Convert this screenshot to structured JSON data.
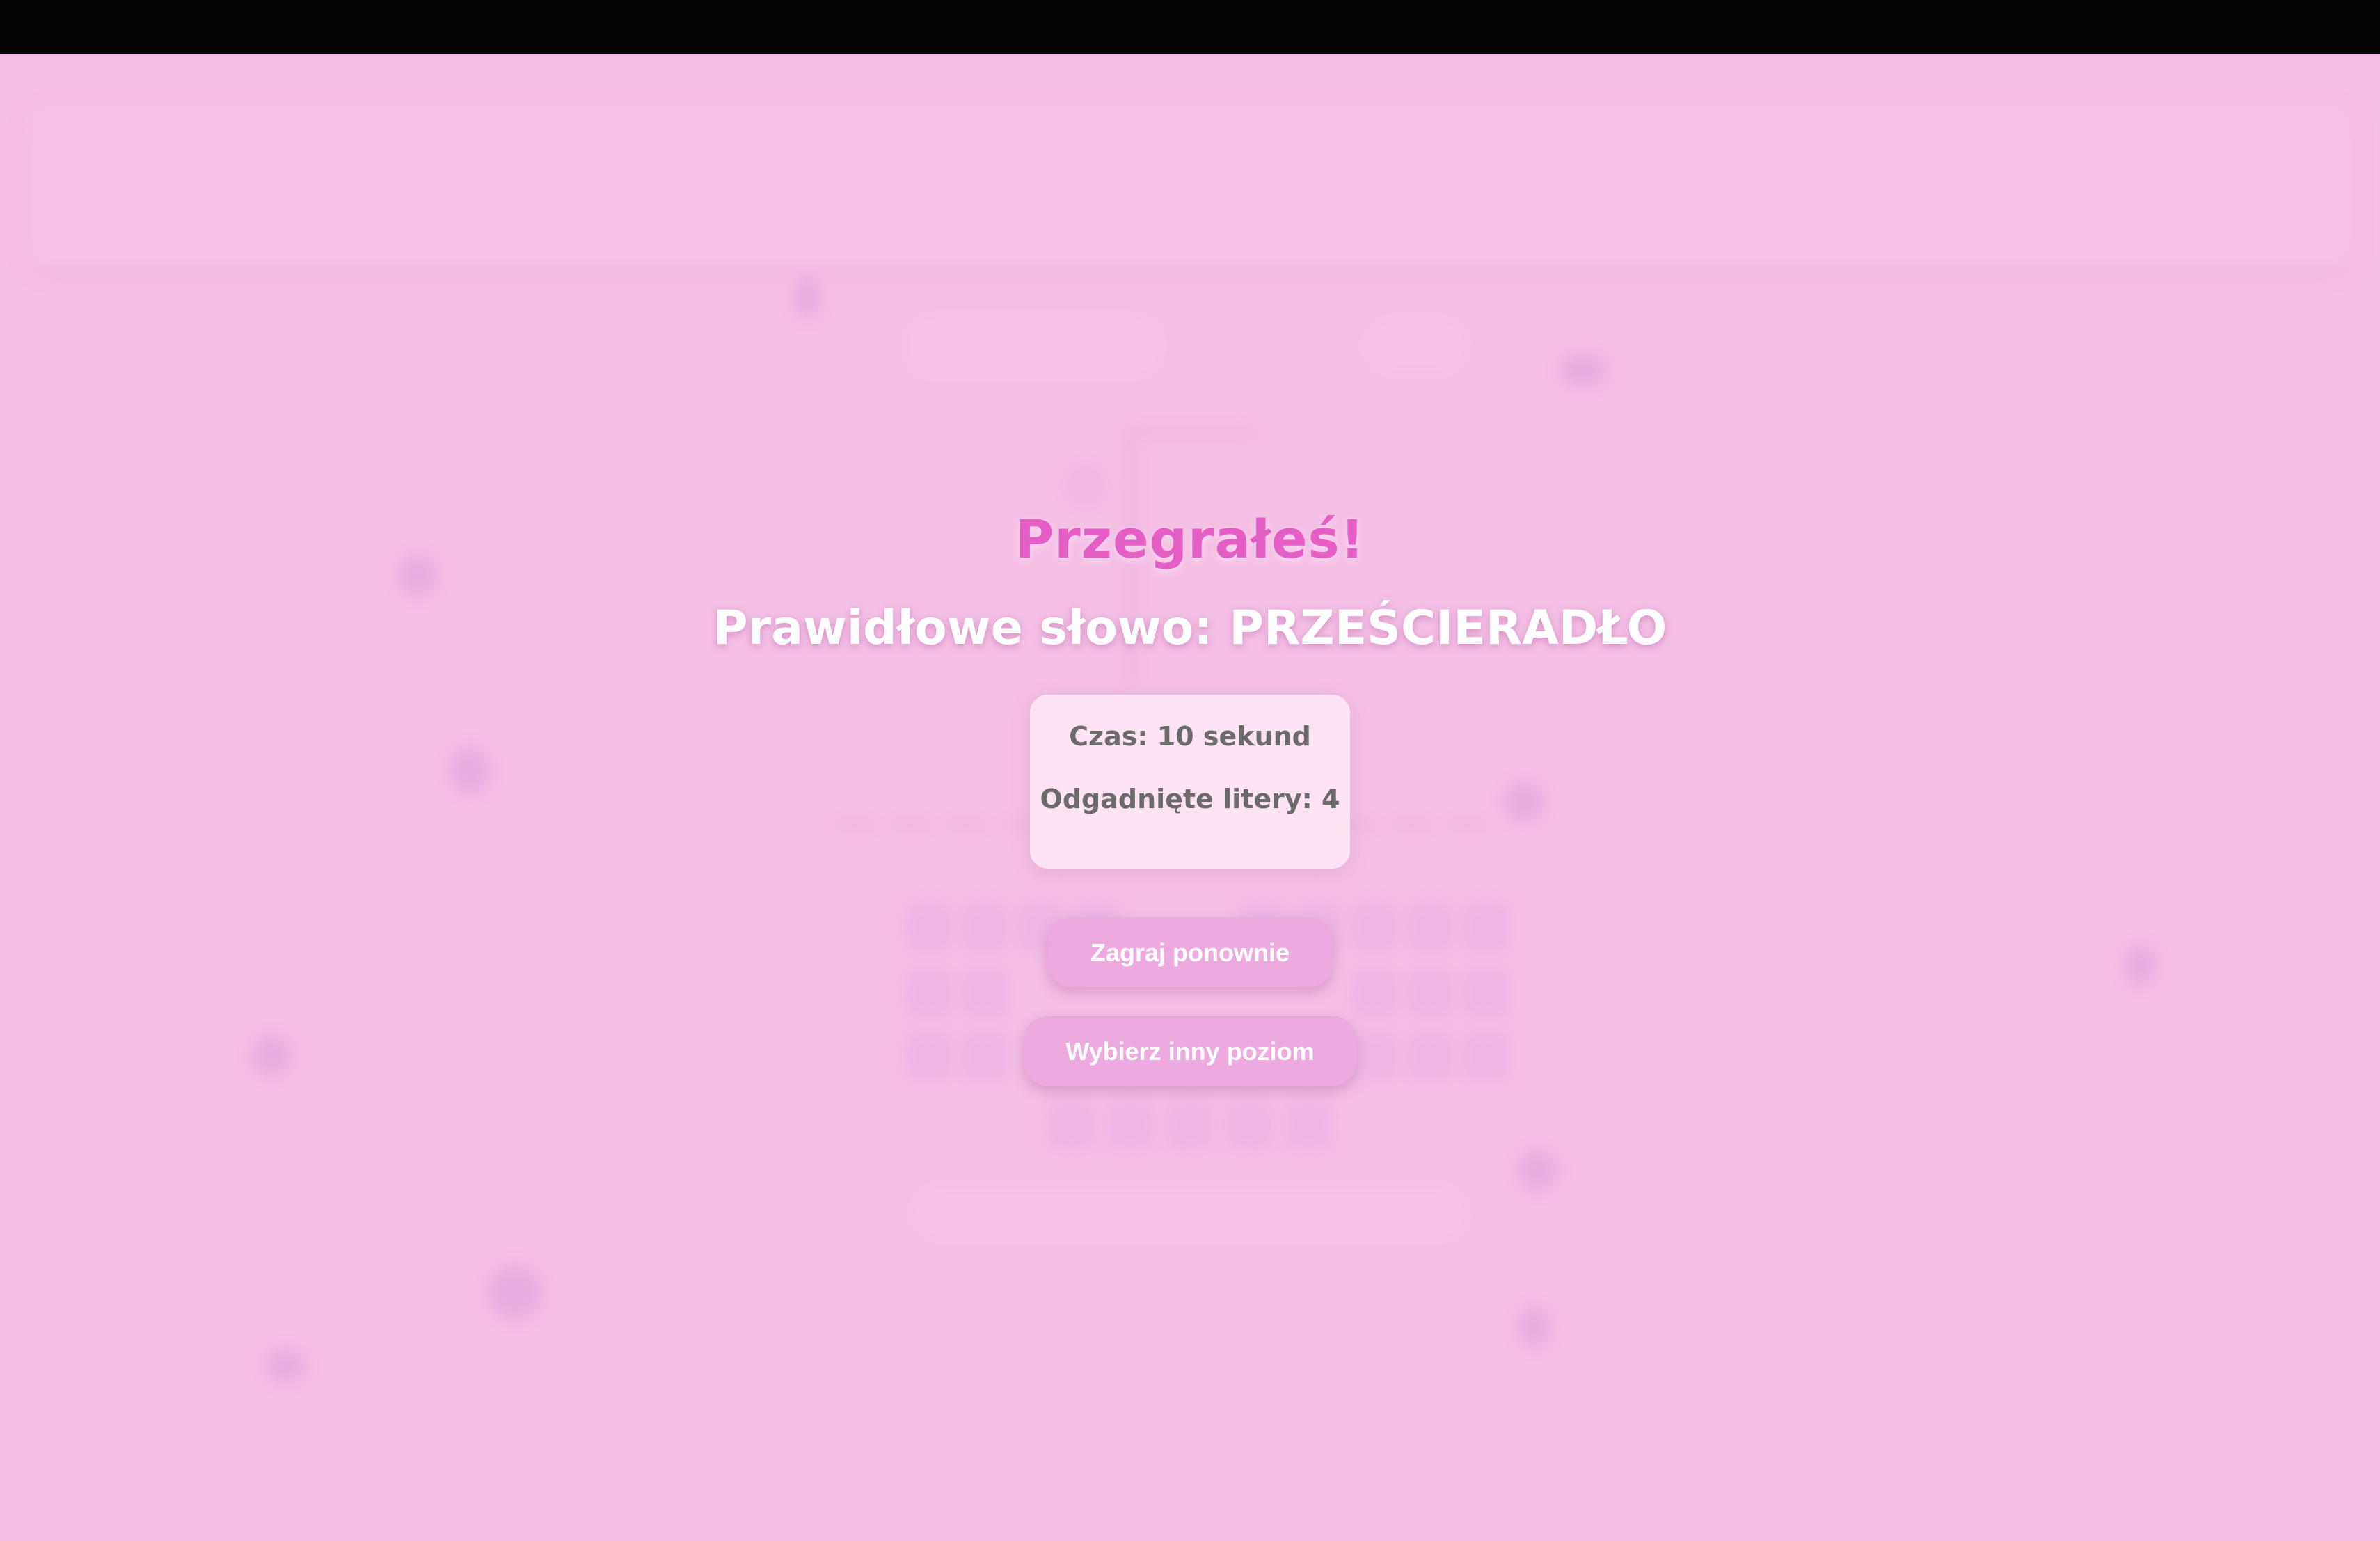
{
  "game": {
    "result_title": "Przegrałeś!",
    "correct_word_label": "Prawidłowe słowo: PRZEŚCIERADŁO",
    "stats": {
      "time": "Czas: 10 sekund",
      "guessed_letters": "Odgadnięte litery: 4"
    },
    "buttons": {
      "play_again": "Zagraj ponownie",
      "choose_level": "Wybierz inny poziom"
    }
  },
  "colors": {
    "background": "#f4c0e4",
    "title": "#e55ec6",
    "button": "#eeaadf",
    "stats_text": "#6b6b6b"
  }
}
